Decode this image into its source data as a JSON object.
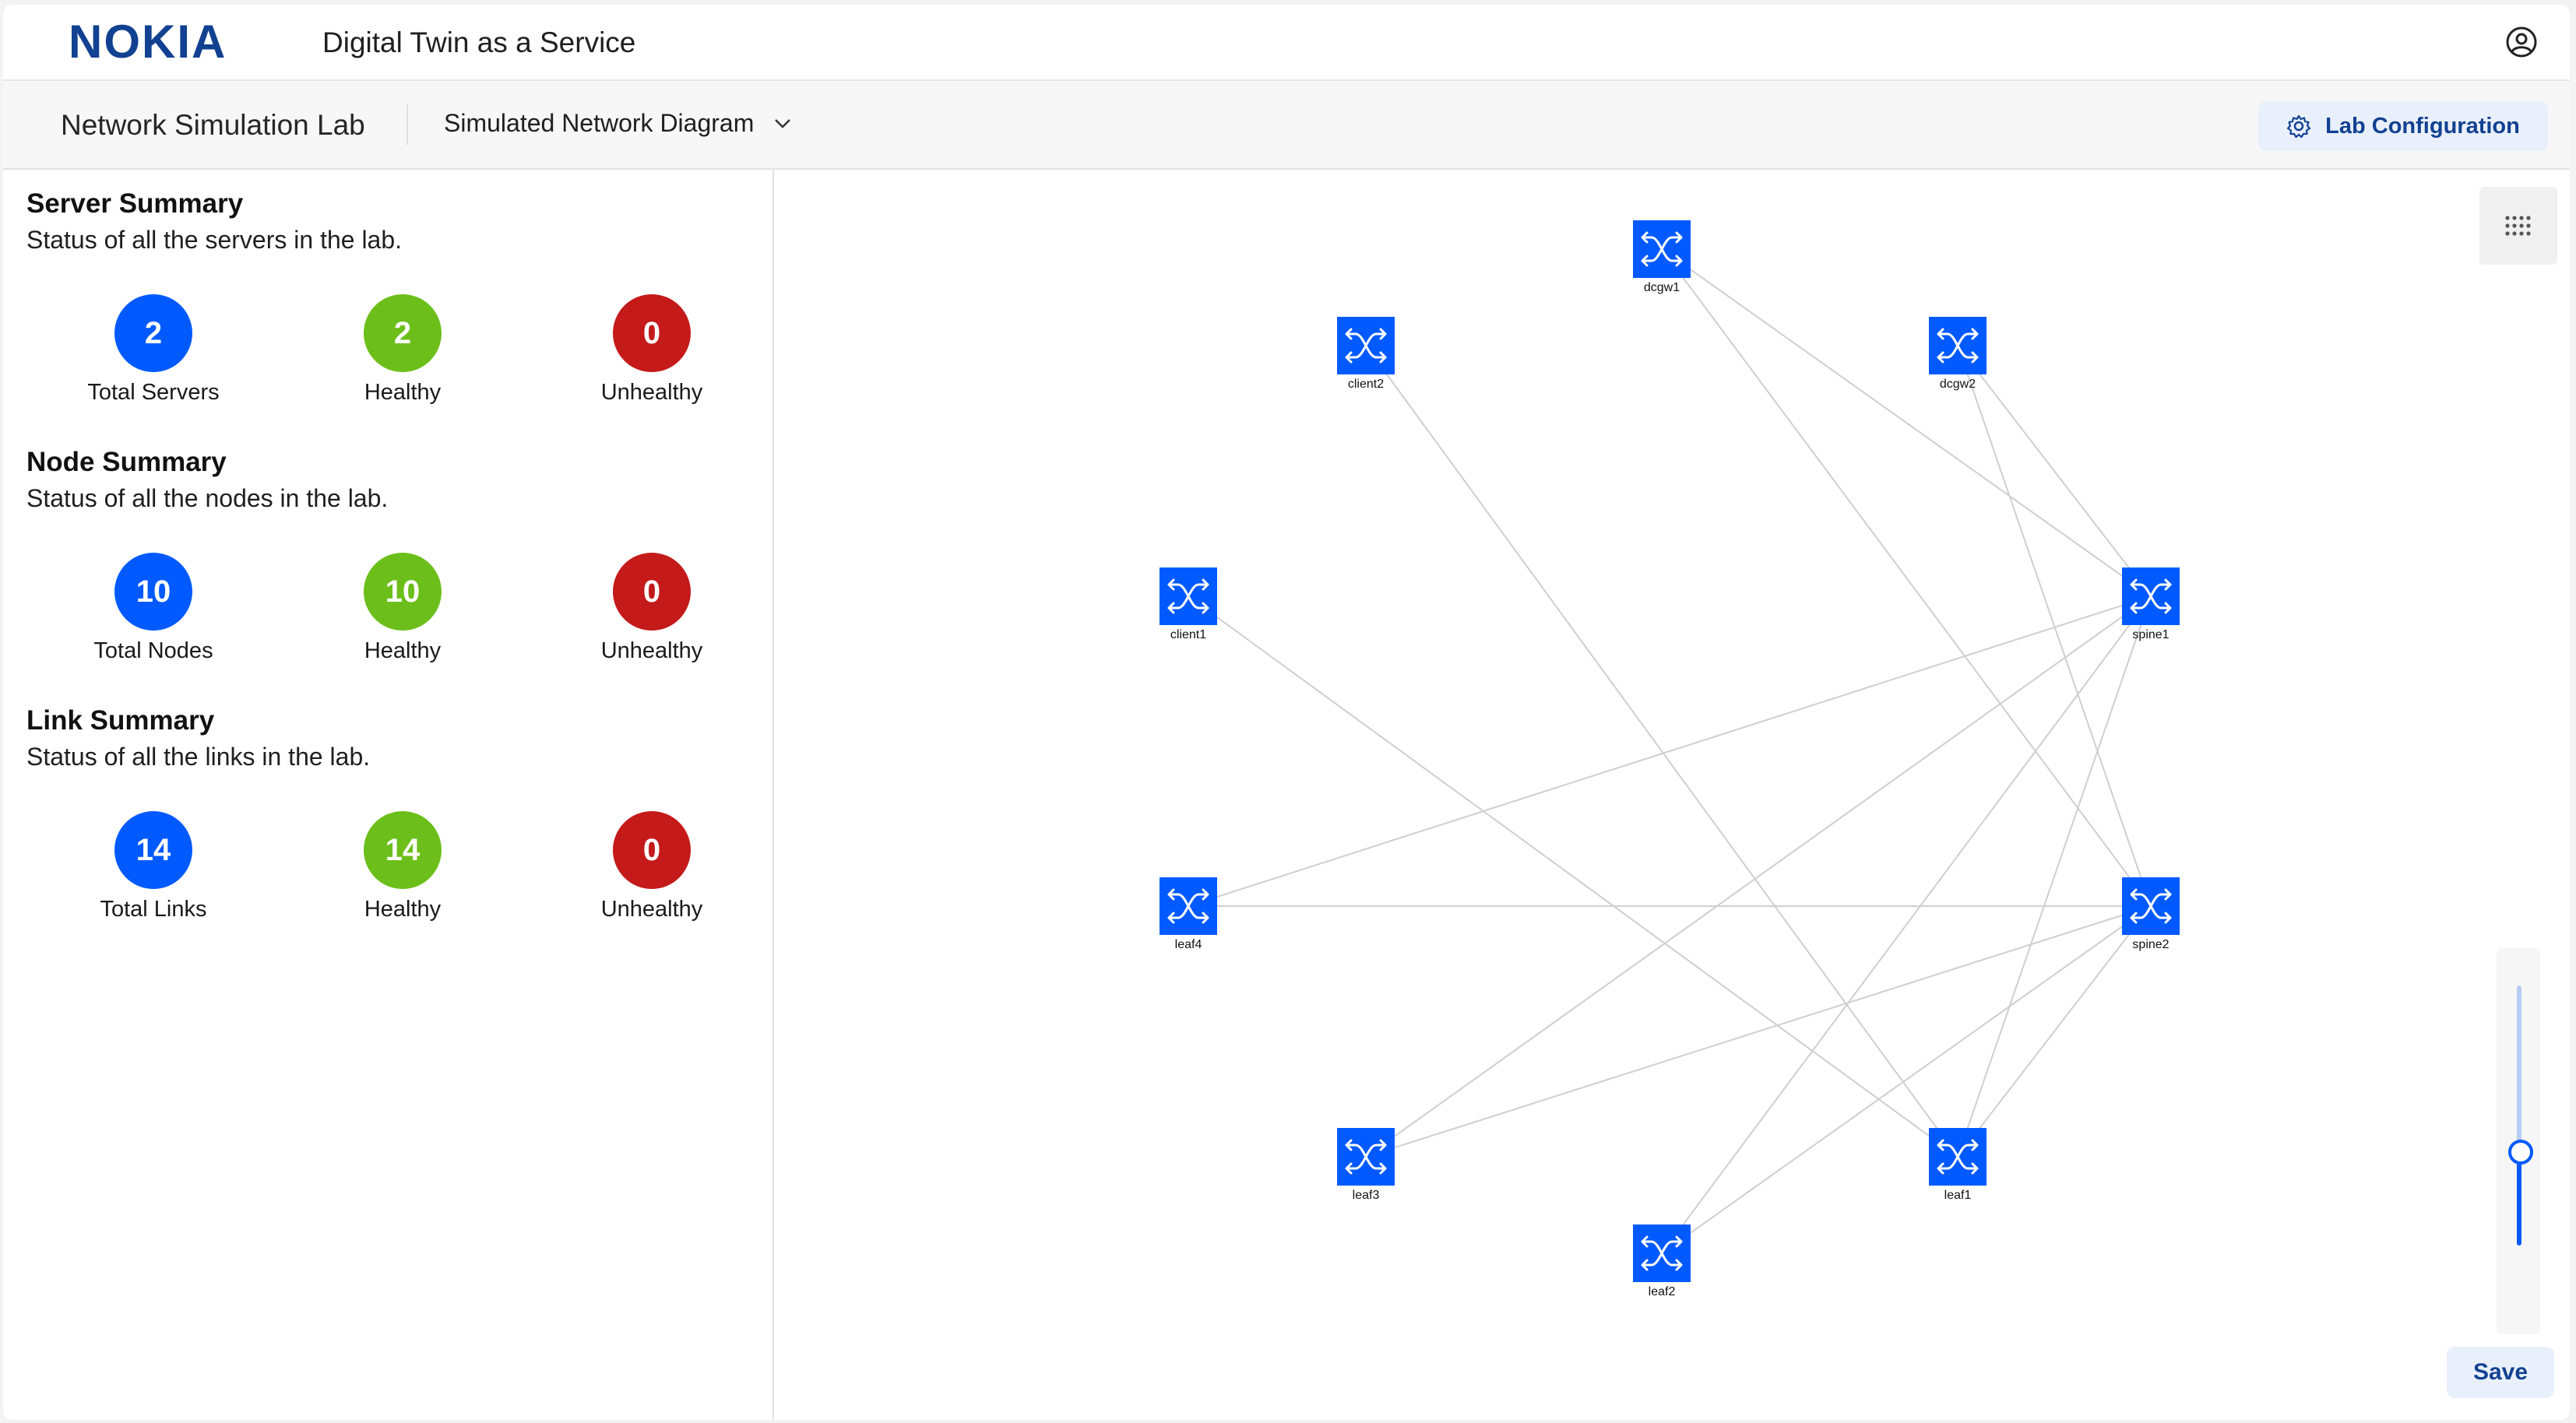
{
  "header": {
    "brand": "NOKIA",
    "app_title": "Digital Twin as a Service",
    "user_icon": "user-circle-icon"
  },
  "subheader": {
    "lab_name": "Network Simulation Lab",
    "view_select": "Simulated Network Diagram",
    "lab_config_label": "Lab Configuration"
  },
  "summaries": {
    "servers": {
      "title": "Server Summary",
      "subtitle": "Status of all the servers in the lab.",
      "total": "2",
      "total_label": "Total Servers",
      "healthy": "2",
      "healthy_label": "Healthy",
      "unhealthy": "0",
      "unhealthy_label": "Unhealthy"
    },
    "nodes": {
      "title": "Node Summary",
      "subtitle": "Status of all the nodes in the lab.",
      "total": "10",
      "total_label": "Total Nodes",
      "healthy": "10",
      "healthy_label": "Healthy",
      "unhealthy": "0",
      "unhealthy_label": "Unhealthy"
    },
    "links": {
      "title": "Link Summary",
      "subtitle": "Status of all the links in the lab.",
      "total": "14",
      "total_label": "Total Links",
      "healthy": "14",
      "healthy_label": "Healthy",
      "unhealthy": "0",
      "unhealthy_label": "Unhealthy"
    }
  },
  "diagram": {
    "nodes": [
      "dcgw1",
      "client2",
      "dcgw2",
      "client1",
      "spine1",
      "leaf4",
      "spine2",
      "leaf3",
      "leaf1",
      "leaf2"
    ],
    "links": [
      [
        "dcgw1",
        "spine1"
      ],
      [
        "dcgw1",
        "spine2"
      ],
      [
        "dcgw2",
        "spine1"
      ],
      [
        "dcgw2",
        "spine2"
      ],
      [
        "client2",
        "leaf1"
      ],
      [
        "client1",
        "leaf1"
      ],
      [
        "leaf4",
        "spine1"
      ],
      [
        "leaf4",
        "spine2"
      ],
      [
        "leaf3",
        "spine1"
      ],
      [
        "leaf3",
        "spine2"
      ],
      [
        "leaf2",
        "spine1"
      ],
      [
        "leaf2",
        "spine2"
      ],
      [
        "leaf1",
        "spine1"
      ],
      [
        "leaf1",
        "spine2"
      ]
    ],
    "zoom_level": 0.36
  },
  "canvas": {
    "grid_icon": "grid-dots-icon",
    "save_label": "Save"
  },
  "colors": {
    "accent": "#005aff",
    "healthy": "#6cbf1a",
    "unhealthy": "#c41a1a",
    "brand": "#124191"
  }
}
